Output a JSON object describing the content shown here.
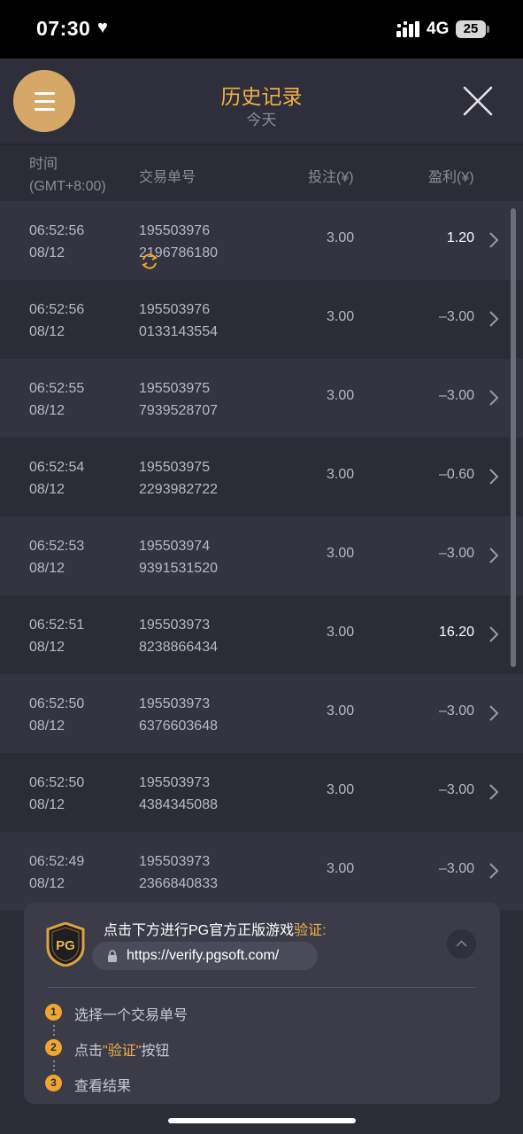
{
  "status_bar": {
    "time": "07:30",
    "network": "4G",
    "battery": "25"
  },
  "header": {
    "title": "历史记录",
    "subtitle": "今天"
  },
  "columns": {
    "time_line1": "时间",
    "time_line2": "(GMT+8:00)",
    "order": "交易单号",
    "bet": "投注(¥)",
    "profit": "盈利(¥)"
  },
  "rows": [
    {
      "time": "06:52:56",
      "date": "08/12",
      "order_a": "195503976",
      "order_b": "2196786180",
      "bet": "3.00",
      "profit": "1.20",
      "win": true,
      "pending_icon": true
    },
    {
      "time": "06:52:56",
      "date": "08/12",
      "order_a": "195503976",
      "order_b": "0133143554",
      "bet": "3.00",
      "profit": "–3.00",
      "win": false
    },
    {
      "time": "06:52:55",
      "date": "08/12",
      "order_a": "195503975",
      "order_b": "7939528707",
      "bet": "3.00",
      "profit": "–3.00",
      "win": false
    },
    {
      "time": "06:52:54",
      "date": "08/12",
      "order_a": "195503975",
      "order_b": "2293982722",
      "bet": "3.00",
      "profit": "–0.60",
      "win": false
    },
    {
      "time": "06:52:53",
      "date": "08/12",
      "order_a": "195503974",
      "order_b": "9391531520",
      "bet": "3.00",
      "profit": "–3.00",
      "win": false
    },
    {
      "time": "06:52:51",
      "date": "08/12",
      "order_a": "195503973",
      "order_b": "8238866434",
      "bet": "3.00",
      "profit": "16.20",
      "win": true
    },
    {
      "time": "06:52:50",
      "date": "08/12",
      "order_a": "195503973",
      "order_b": "6376603648",
      "bet": "3.00",
      "profit": "–3.00",
      "win": false
    },
    {
      "time": "06:52:50",
      "date": "08/12",
      "order_a": "195503973",
      "order_b": "4384345088",
      "bet": "3.00",
      "profit": "–3.00",
      "win": false
    },
    {
      "time": "06:52:49",
      "date": "08/12",
      "order_a": "195503973",
      "order_b": "2366840833",
      "bet": "3.00",
      "profit": "–3.00",
      "win": false
    }
  ],
  "verify": {
    "logo_text": "PG",
    "prompt": "点击下方进行PG官方正版游戏",
    "prompt_highlight": "验证",
    "prompt_colon": ":",
    "url": "https://verify.pgsoft.com/",
    "steps": [
      {
        "num": "1",
        "pre": "选择一个交易单号",
        "hl": "",
        "post": ""
      },
      {
        "num": "2",
        "pre": "点击",
        "hl": "\"验证\"",
        "post": "按钮"
      },
      {
        "num": "3",
        "pre": "查看结果",
        "hl": "",
        "post": ""
      }
    ]
  },
  "colors": {
    "accent": "#f0b04a",
    "menu_button": "#d6a868",
    "row_dark": "#2b2c36",
    "row_light": "#33343f"
  },
  "icons": {
    "menu": "hamburger-icon",
    "close": "close-icon",
    "row_detail": "chevron-right-icon",
    "pending": "refresh-icon",
    "url": "lock-icon",
    "collapse": "chevron-up-icon"
  }
}
